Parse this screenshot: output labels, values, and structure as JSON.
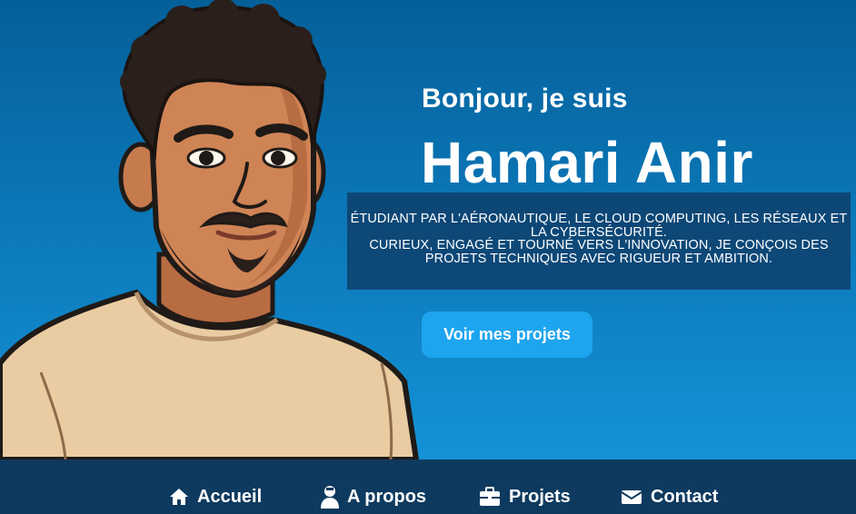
{
  "hero": {
    "greeting": "Bonjour, je suis",
    "name": "Hamari Anir",
    "description_line1": "Étudiant  par l'aéronautique, le cloud computing, les réseaux et la cybersécurité.",
    "description_line2": "Curieux, engagé et tourné vers l'innovation, je conçois des projets techniques avec rigueur et ambition.",
    "cta_label": "Voir mes projets"
  },
  "nav": {
    "items": [
      {
        "label": "Accueil",
        "icon": "home-icon"
      },
      {
        "label": "A propos",
        "icon": "person-icon"
      },
      {
        "label": "Projets",
        "icon": "briefcase-icon"
      },
      {
        "label": "Contact",
        "icon": "envelope-icon"
      }
    ]
  },
  "colors": {
    "hero_top": "#055f99",
    "hero_bottom": "#1592d8",
    "button": "#1ea5f0",
    "navbar": "#0e3a5f",
    "description_box": "#0e3a64"
  }
}
